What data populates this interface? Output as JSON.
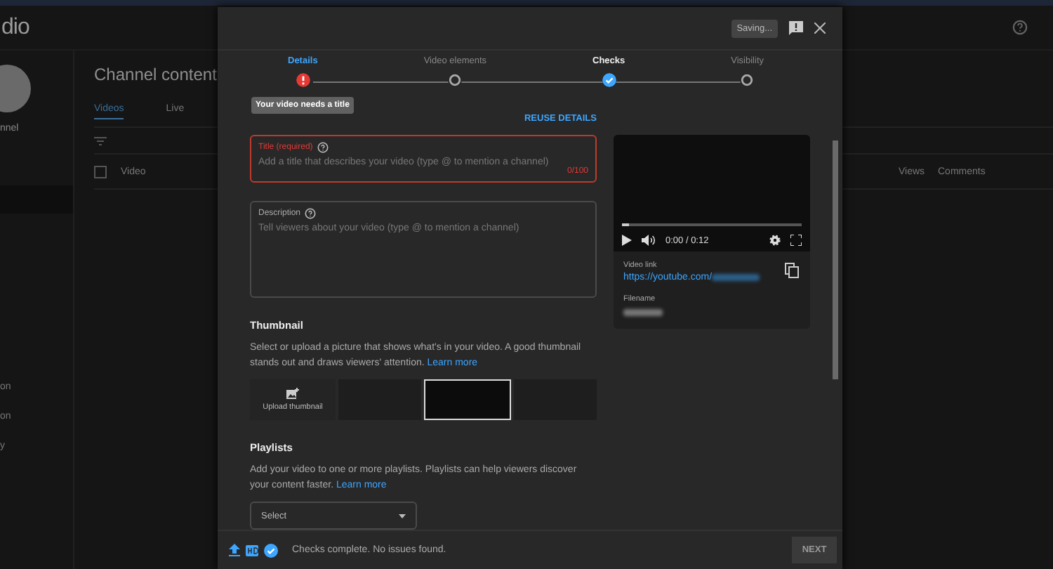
{
  "background_page": {
    "logo": "dio",
    "channel_name": "nnel",
    "heading": "Channel content",
    "tabs": [
      {
        "label": "Videos",
        "selected": true
      },
      {
        "label": "Live",
        "selected": false
      }
    ],
    "columns": [
      "Video",
      "Views",
      "Comments"
    ],
    "select_all_checked": false,
    "sidebar_items": [
      "on",
      "on",
      "y"
    ]
  },
  "dialog": {
    "status_badge": "Saving...",
    "steps": [
      {
        "label": "Details",
        "kind": "error",
        "current": true
      },
      {
        "label": "Video elements",
        "kind": "pending",
        "current": false
      },
      {
        "label": "Checks",
        "kind": "done",
        "current": false
      },
      {
        "label": "Visibility",
        "kind": "pending",
        "current": false
      }
    ],
    "tooltip": "Your video needs a title",
    "reuse_button": "REUSE DETAILS",
    "title_field": {
      "label": "Title (required)",
      "placeholder": "Add a title that describes your video (type @ to mention a channel)",
      "counter": "0/100",
      "error": true
    },
    "description_field": {
      "label": "Description",
      "placeholder": "Tell viewers about your video (type @ to mention a channel)"
    },
    "thumbnail": {
      "heading": "Thumbnail",
      "text": "Select or upload a picture that shows what's in your video. A good thumbnail stands out and draws viewers' attention.",
      "link": "Learn more",
      "upload_label": "Upload thumbnail",
      "options": [
        {
          "selected": false
        },
        {
          "selected": true
        },
        {
          "selected": false
        }
      ]
    },
    "playlists": {
      "heading": "Playlists",
      "text": "Add your video to one or more playlists. Playlists can help viewers discover your content faster.",
      "link": "Learn more",
      "select": "Select"
    },
    "preview": {
      "time": "0:00 / 0:12",
      "level": 0.04,
      "link_label": "Video link",
      "link": "https://youtube.com/",
      "filename_label": "Filename"
    },
    "footer": {
      "status": "Checks complete. No issues found.",
      "next_button": "NEXT",
      "next_disabled": true
    }
  }
}
